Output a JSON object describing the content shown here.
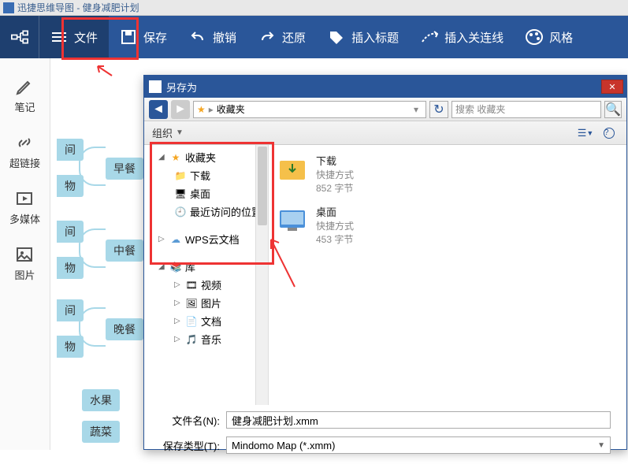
{
  "app": {
    "title": "迅捷思维导图 - 健身减肥计划"
  },
  "toolbar": {
    "file": "文件",
    "save": "保存",
    "undo": "撤销",
    "redo": "还原",
    "insert_title": "插入标题",
    "insert_link": "插入关连线",
    "style": "风格"
  },
  "sidebar": {
    "note": "笔记",
    "hyperlink": "超链接",
    "media": "多媒体",
    "image": "图片"
  },
  "mindmap": {
    "breakfast": "早餐",
    "lunch": "中餐",
    "dinner": "晚餐",
    "time": "间",
    "food": "物",
    "fruit": "水果",
    "veg": "蔬菜"
  },
  "dialog": {
    "title": "另存为",
    "breadcrumb": "收藏夹",
    "search_placeholder": "搜索 收藏夹",
    "organize": "组织",
    "tree": {
      "favorites": "收藏夹",
      "downloads": "下载",
      "desktop": "桌面",
      "recent": "最近访问的位置",
      "wps": "WPS云文档",
      "library": "库",
      "video": "视频",
      "pictures": "图片",
      "documents": "文档",
      "music": "音乐"
    },
    "files": [
      {
        "name": "下载",
        "type": "快捷方式",
        "size": "852 字节"
      },
      {
        "name": "桌面",
        "type": "快捷方式",
        "size": "453 字节"
      }
    ],
    "filename_label": "文件名(N):",
    "filename_value": "健身减肥计划.xmm",
    "filetype_label": "保存类型(T):",
    "filetype_value": "Mindomo Map (*.xmm)"
  }
}
